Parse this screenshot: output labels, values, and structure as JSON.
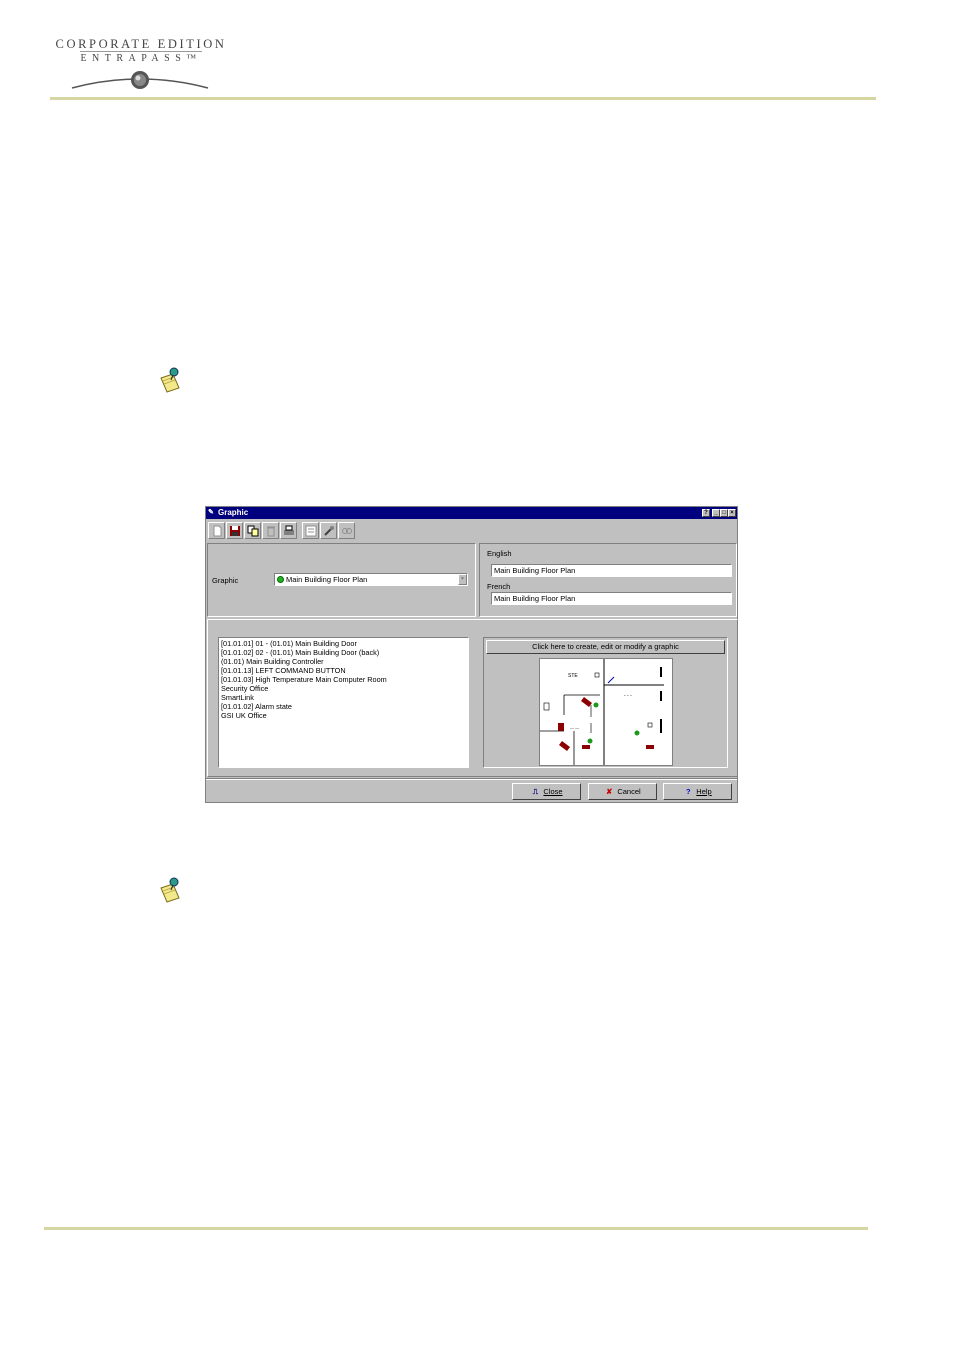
{
  "header": {
    "logo_line1": "CORPORATE EDITION",
    "logo_line2": "ENTRAPASS™"
  },
  "dialog": {
    "title": "Graphic",
    "title_buttons": [
      "?",
      "_",
      "□",
      "×"
    ],
    "toolbar_icons": [
      "new-icon",
      "save-icon",
      "copy-icon",
      "delete-icon",
      "print-icon",
      "list-icon",
      "link-icon",
      "find-icon"
    ],
    "graphic_label": "Graphic",
    "graphic_value": "Main Building Floor Plan",
    "english_label": "English",
    "english_value": "Main Building Floor Plan",
    "french_label": "French",
    "french_value": "Main Building Floor Plan",
    "list_items": [
      "[01.01.01] 01 - (01.01) Main Building Door",
      "[01.01.02] 02 - (01.01) Main Building Door (back)",
      "(01.01) Main Building Controller",
      "[01.01.13] LEFT COMMAND BUTTON",
      "[01.01.03] High Temperature Main Computer Room",
      "Security Office",
      "SmartLink",
      "[01.01.02] Alarm state",
      "GSI UK Office"
    ],
    "preview_button": "Click here to create, edit or modify a graphic",
    "buttons": {
      "close": "Close",
      "cancel": "Cancel",
      "help": "Help"
    }
  }
}
